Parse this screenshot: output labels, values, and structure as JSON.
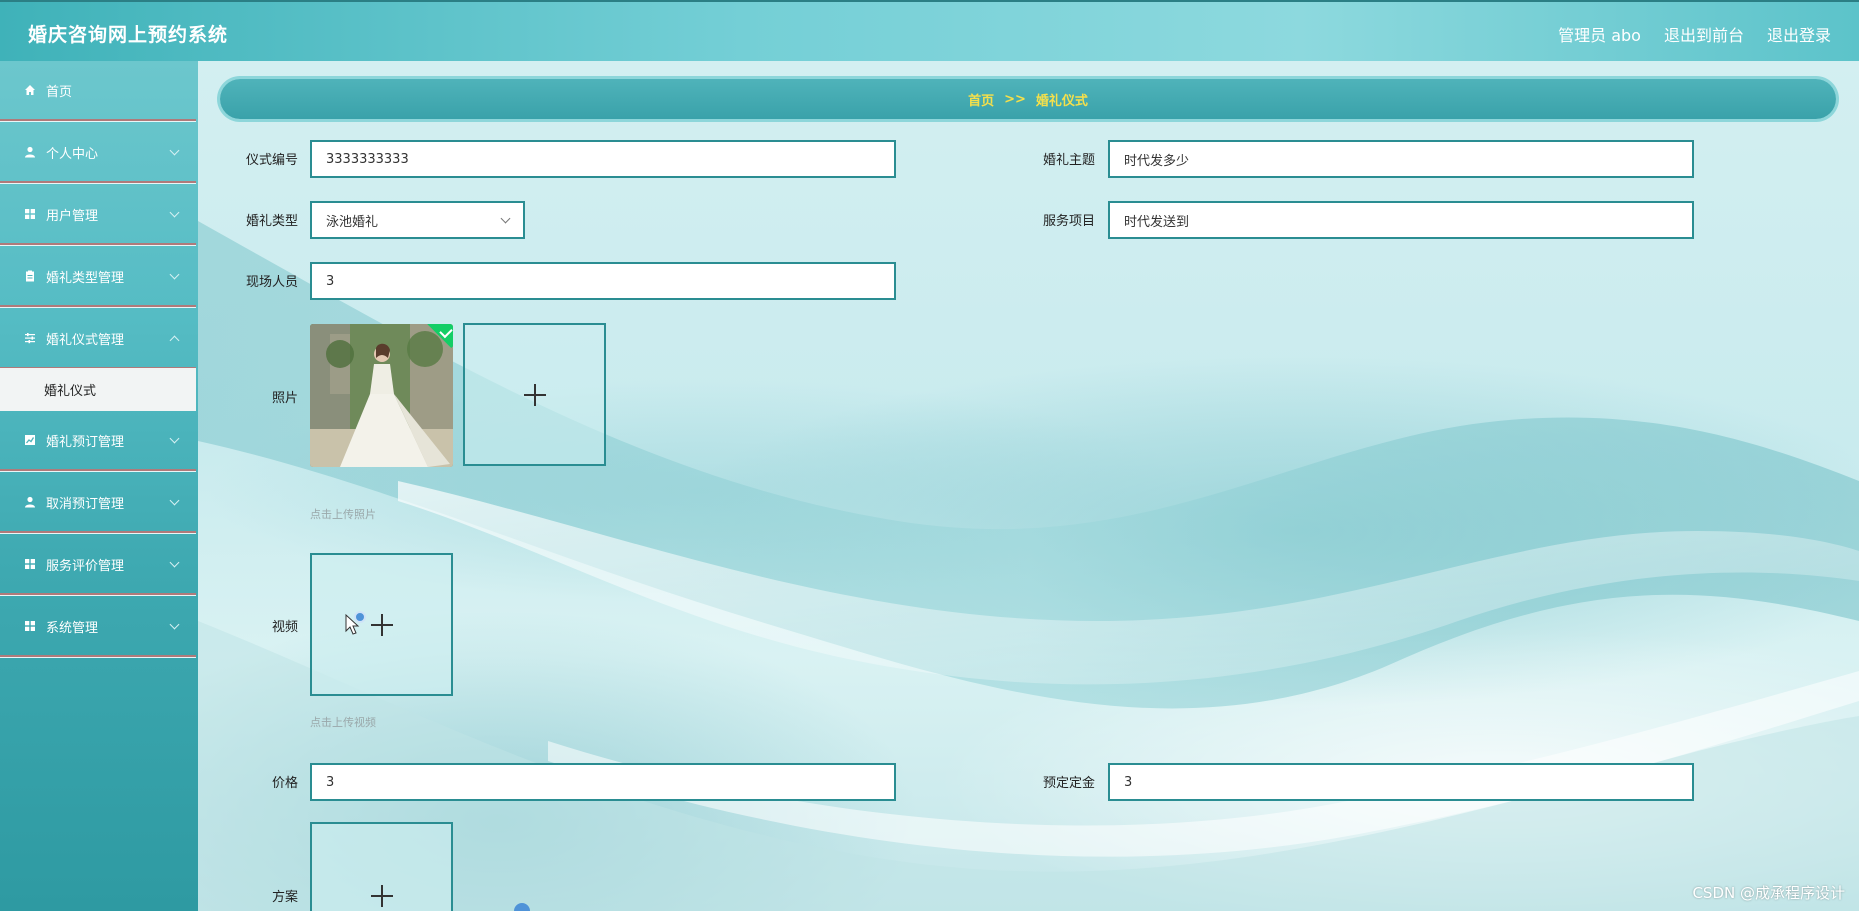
{
  "app": {
    "title": "婚庆咨询网上预约系统"
  },
  "header": {
    "user_label": "管理员 abo",
    "front_link": "退出到前台",
    "logout_link": "退出登录"
  },
  "sidebar": {
    "items": [
      {
        "label": "首页",
        "icon": "home-icon"
      },
      {
        "label": "个人中心",
        "icon": "user-icon"
      },
      {
        "label": "用户管理",
        "icon": "grid-icon"
      },
      {
        "label": "婚礼类型管理",
        "icon": "clipboard-icon"
      },
      {
        "label": "婚礼仪式管理",
        "icon": "sliders-icon"
      },
      {
        "label": "婚礼预订管理",
        "icon": "chart-icon"
      },
      {
        "label": "取消预订管理",
        "icon": "user-icon"
      },
      {
        "label": "服务评价管理",
        "icon": "grid-icon"
      },
      {
        "label": "系统管理",
        "icon": "grid-icon"
      }
    ],
    "active_sub": "婚礼仪式"
  },
  "breadcrumb": {
    "home": "首页",
    "separator": ">>",
    "current": "婚礼仪式"
  },
  "form": {
    "ceremony_no": {
      "label": "仪式编号",
      "value": "3333333333"
    },
    "theme": {
      "label": "婚礼主题",
      "value": "时代发多少"
    },
    "type": {
      "label": "婚礼类型",
      "value": "泳池婚礼"
    },
    "service": {
      "label": "服务项目",
      "value": "时代发送到"
    },
    "staff": {
      "label": "现场人员",
      "value": "3"
    },
    "photo": {
      "label": "照片",
      "hint": "点击上传照片"
    },
    "video": {
      "label": "视频",
      "hint": "点击上传视频"
    },
    "price": {
      "label": "价格",
      "value": "3"
    },
    "deposit": {
      "label": "预定定金",
      "value": "3"
    },
    "plan": {
      "label": "方案"
    }
  },
  "watermark": "CSDN @成承程序设计",
  "colors": {
    "accent": "#2a8d92",
    "breadcrumb_text": "#f5e04b",
    "success": "#13ce66"
  }
}
